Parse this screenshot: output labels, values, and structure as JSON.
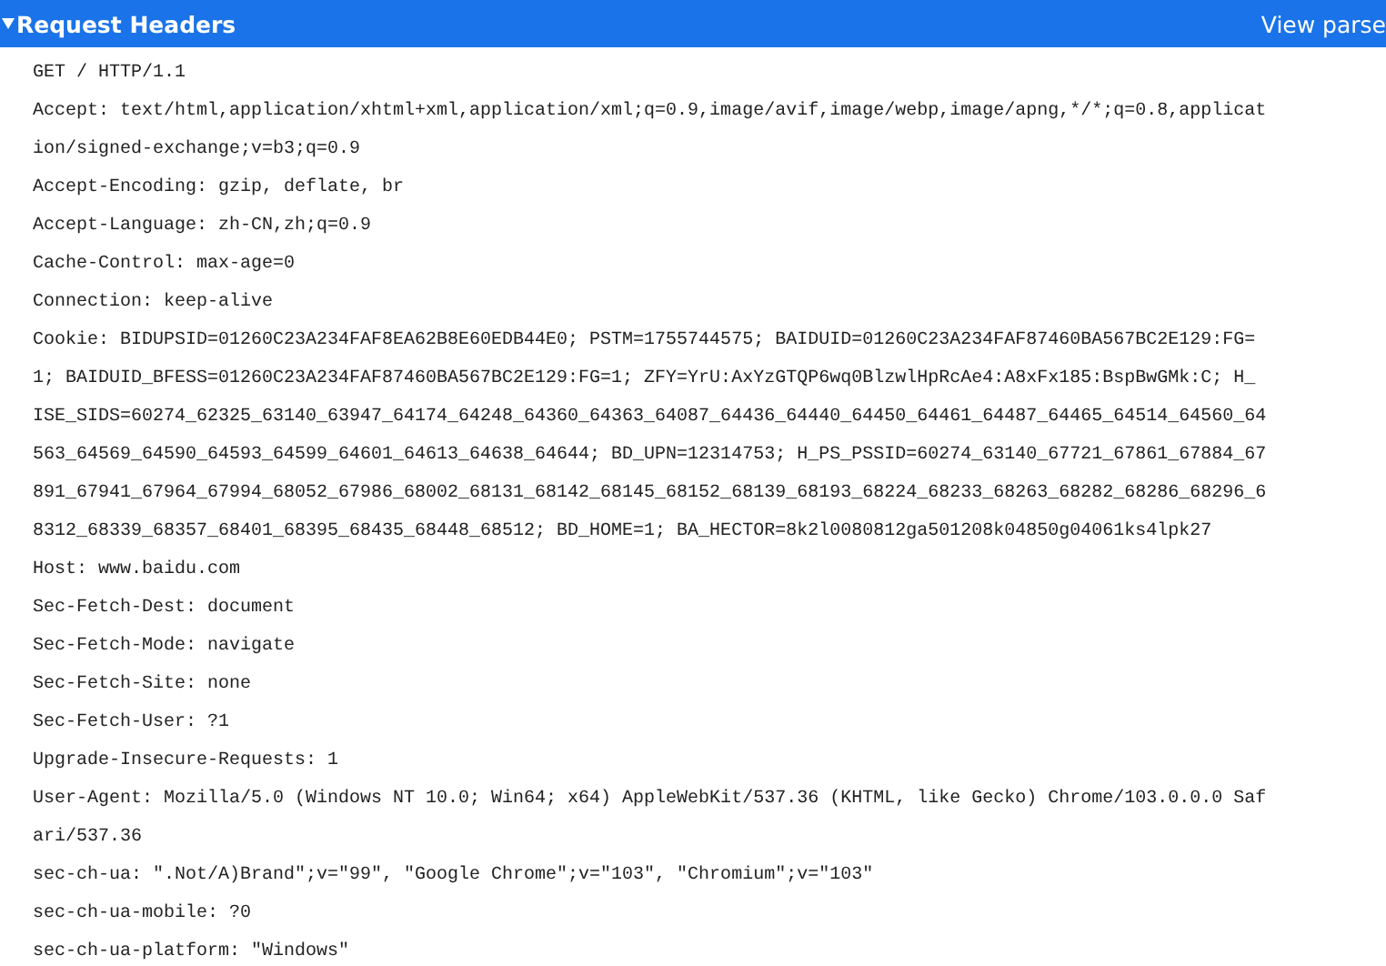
{
  "section": {
    "title": "Request Headers",
    "expanded": true,
    "action": "View parse",
    "lines": [
      "GET / HTTP/1.1",
      "Accept: text/html,application/xhtml+xml,application/xml;q=0.9,image/avif,image/webp,image/apng,*/*;q=0.8,applicat",
      "ion/signed-exchange;v=b3;q=0.9",
      "Accept-Encoding: gzip, deflate, br",
      "Accept-Language: zh-CN,zh;q=0.9",
      "Cache-Control: max-age=0",
      "Connection: keep-alive",
      "Cookie: BIDUPSID=01260C23A234FAF8EA62B8E60EDB44E0; PSTM=1755744575; BAIDUID=01260C23A234FAF87460BA567BC2E129:FG=",
      "1; BAIDUID_BFESS=01260C23A234FAF87460BA567BC2E129:FG=1; ZFY=YrU:AxYzGTQP6wq0BlzwlHpRcAe4:A8xFx185:BspBwGMk:C; H_",
      "ISE_SIDS=60274_62325_63140_63947_64174_64248_64360_64363_64087_64436_64440_64450_64461_64487_64465_64514_64560_64",
      "563_64569_64590_64593_64599_64601_64613_64638_64644; BD_UPN=12314753; H_PS_PSSID=60274_63140_67721_67861_67884_67",
      "891_67941_67964_67994_68052_67986_68002_68131_68142_68145_68152_68139_68193_68224_68233_68263_68282_68286_68296_6",
      "8312_68339_68357_68401_68395_68435_68448_68512; BD_HOME=1; BA_HECTOR=8k2l0080812ga501208k04850g04061ks4lpk27",
      "Host: www.baidu.com",
      "Sec-Fetch-Dest: document",
      "Sec-Fetch-Mode: navigate",
      "Sec-Fetch-Site: none",
      "Sec-Fetch-User: ?1",
      "Upgrade-Insecure-Requests: 1",
      "User-Agent: Mozilla/5.0 (Windows NT 10.0; Win64; x64) AppleWebKit/537.36 (KHTML, like Gecko) Chrome/103.0.0.0 Saf",
      "ari/537.36",
      "sec-ch-ua: \".Not/A)Brand\";v=\"99\", \"Google Chrome\";v=\"103\", \"Chromium\";v=\"103\"",
      "sec-ch-ua-mobile: ?0",
      "sec-ch-ua-platform: \"Windows\""
    ]
  }
}
